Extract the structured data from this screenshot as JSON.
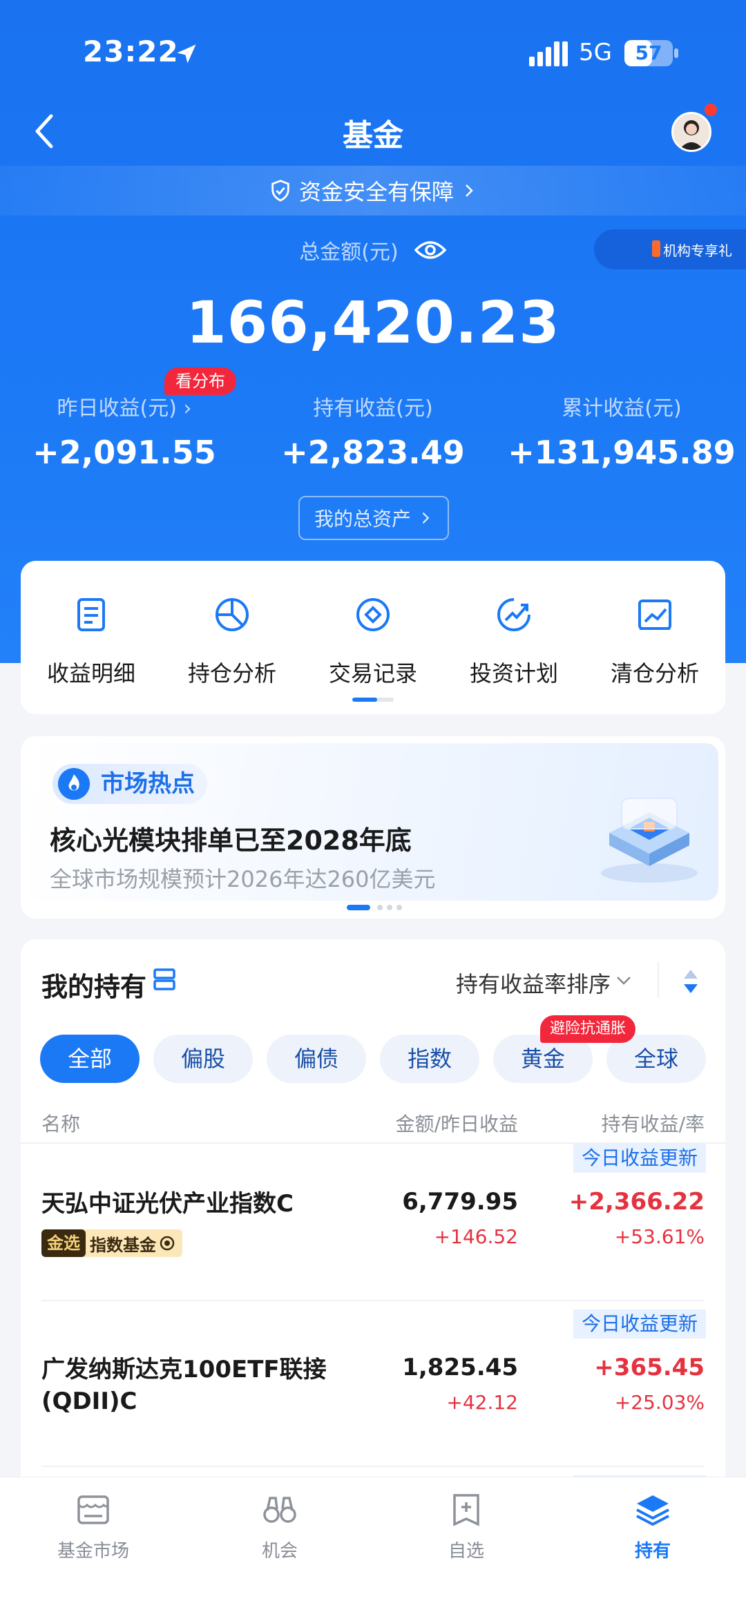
{
  "status_bar": {
    "time": "23:22",
    "network": "5G",
    "battery": "57",
    "battery_level": 0.57
  },
  "nav": {
    "title": "基金"
  },
  "safety_banner": {
    "text": "资金安全有保障"
  },
  "summary": {
    "total_label": "总金额(元)",
    "total_amount": "166,420.23",
    "distribution_badge": "看分布",
    "stats": [
      {
        "label": "昨日收益(元)",
        "value": "+2,091.55"
      },
      {
        "label": "持有收益(元)",
        "value": "+2,823.49"
      },
      {
        "label": "累计收益(元)",
        "value": "+131,945.89"
      }
    ],
    "assets_button": "我的总资产",
    "promo_tag": "机构专享礼"
  },
  "tools": [
    {
      "label": "收益明细",
      "icon": "document-icon"
    },
    {
      "label": "持仓分析",
      "icon": "pie-chart-icon"
    },
    {
      "label": "交易记录",
      "icon": "diamond-circle-icon"
    },
    {
      "label": "投资计划",
      "icon": "trend-up-icon"
    },
    {
      "label": "清仓分析",
      "icon": "line-chart-icon"
    }
  ],
  "market_hot": {
    "tag": "市场热点",
    "title": "核心光模块排单已至2028年底",
    "subtitle": "全球市场规模预计2026年达260亿美元"
  },
  "holdings": {
    "title": "我的持有",
    "sort_label": "持有收益率排序",
    "filters": [
      "全部",
      "偏股",
      "偏债",
      "指数",
      "黄金",
      "全球"
    ],
    "active_filter": "全部",
    "gold_badge": "避险抗通胀",
    "columns": {
      "name": "名称",
      "amount": "金额/昨日收益",
      "profit": "持有收益/率"
    },
    "update_tag": "今日收益更新",
    "funds": [
      {
        "name": "天弘中证光伏产业指数C",
        "amount": "6,779.95",
        "day_profit": "+146.52",
        "hold_profit": "+2,366.22",
        "hold_rate": "+53.61%",
        "tag_primary": "金选",
        "tag_secondary": "指数基金"
      },
      {
        "name": "广发纳斯达克100ETF联接(QDII)C",
        "amount": "1,825.45",
        "day_profit": "+42.12",
        "hold_profit": "+365.45",
        "hold_rate": "+25.03%"
      }
    ]
  },
  "tab_bar": [
    {
      "label": "基金市场",
      "icon": "market-icon"
    },
    {
      "label": "机会",
      "icon": "binoculars-icon"
    },
    {
      "label": "自选",
      "icon": "add-bookmark-icon"
    },
    {
      "label": "持有",
      "icon": "layers-icon"
    }
  ],
  "active_tab": "持有",
  "colors": {
    "brand_blue": "#1c79f6",
    "profit_red": "#e5323f",
    "badge_red": "#f3273c"
  }
}
